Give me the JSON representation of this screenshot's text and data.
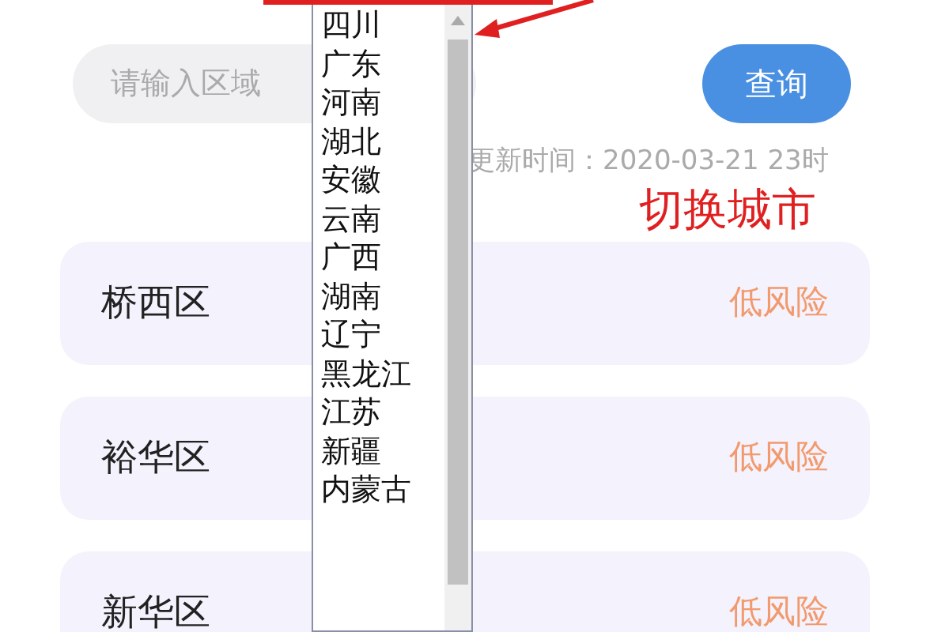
{
  "search": {
    "placeholder": "请输入区域",
    "button": "查询"
  },
  "update_time": "更新时间：2020-03-21 23时",
  "annotation": "切换城市",
  "districts": [
    {
      "name": "桥西区",
      "risk": "低风险"
    },
    {
      "name": "裕华区",
      "risk": "低风险"
    },
    {
      "name": "新华区",
      "risk": "低风险"
    }
  ],
  "dropdown": {
    "items": [
      "四川",
      "广东",
      "河南",
      "湖北",
      "安徽",
      "云南",
      "广西",
      "湖南",
      "辽宁",
      "黑龙江",
      "江苏",
      "新疆",
      "内蒙古"
    ]
  }
}
